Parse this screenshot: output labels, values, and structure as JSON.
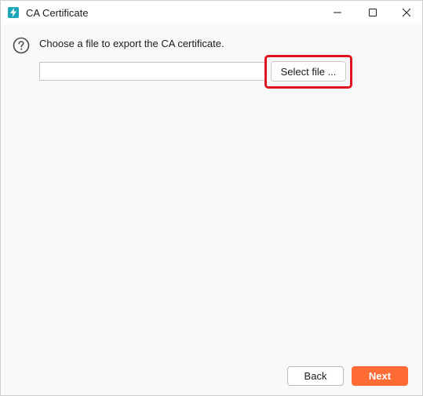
{
  "window": {
    "title": "CA Certificate",
    "app_icon": "lightning-bolt-icon",
    "controls": [
      "minimize-icon",
      "maximize-icon",
      "close-icon"
    ]
  },
  "main": {
    "help_icon": "question-circle-icon",
    "prompt": "Choose a file to export the CA certificate.",
    "file_path_value": "",
    "select_file_label": "Select file ..."
  },
  "footer": {
    "back_label": "Back",
    "next_label": "Next"
  },
  "colors": {
    "accent": "#ff6b35",
    "app_icon_bg": "#1aa6b7",
    "highlight": "#e0141e"
  }
}
